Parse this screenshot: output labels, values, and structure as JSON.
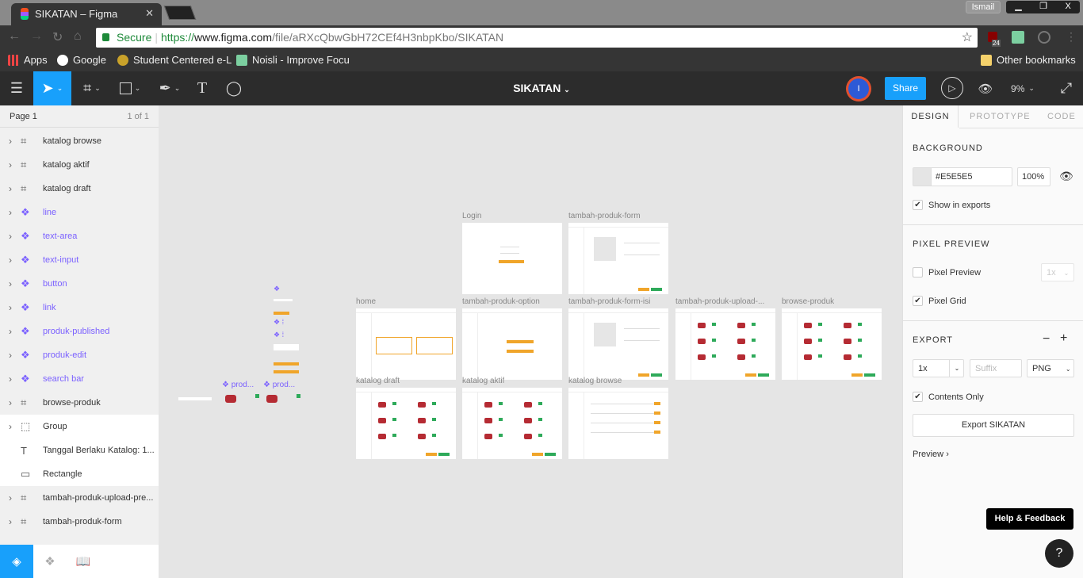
{
  "browser": {
    "tab_title": "SIKATAN – Figma",
    "user": "Ismail",
    "secure_label": "Secure",
    "url_scheme": "https://",
    "url_domain": "www.figma.com",
    "url_path": "/file/aRXcQbwGbH72CEf4H3nbpKbo/SIKATAN",
    "ext_badge": "24",
    "bookmarks": [
      {
        "label": "Apps"
      },
      {
        "label": "Google"
      },
      {
        "label": "Student Centered e-L"
      },
      {
        "label": "Noisli - Improve Focu"
      }
    ],
    "other_bookmarks": "Other bookmarks"
  },
  "toolbar": {
    "file_title": "SIKATAN",
    "avatar_initial": "I",
    "share_label": "Share",
    "zoom": "9%"
  },
  "layers": {
    "page_name": "Page 1",
    "page_count": "1 of 1",
    "items": [
      {
        "label": "katalog browse",
        "type": "frame"
      },
      {
        "label": "katalog aktif",
        "type": "frame"
      },
      {
        "label": "katalog draft",
        "type": "frame"
      },
      {
        "label": "line",
        "type": "component"
      },
      {
        "label": "text-area",
        "type": "component"
      },
      {
        "label": "text-input",
        "type": "component"
      },
      {
        "label": "button",
        "type": "component"
      },
      {
        "label": "link",
        "type": "component"
      },
      {
        "label": "produk-published",
        "type": "component"
      },
      {
        "label": "produk-edit",
        "type": "component"
      },
      {
        "label": "search bar",
        "type": "component"
      },
      {
        "label": "browse-produk",
        "type": "frame"
      },
      {
        "label": "Group",
        "type": "group"
      },
      {
        "label": "Tanggal Berlaku Katalog: 1...",
        "type": "text"
      },
      {
        "label": "Rectangle",
        "type": "rect"
      },
      {
        "label": "tambah-produk-upload-pre...",
        "type": "frame"
      },
      {
        "label": "tambah-produk-form",
        "type": "frame"
      }
    ]
  },
  "canvas": {
    "background": "#E5E5E5",
    "frames": [
      {
        "label": "Login"
      },
      {
        "label": "tambah-produk-form"
      },
      {
        "label": "home"
      },
      {
        "label": "tambah-produk-option"
      },
      {
        "label": "tambah-produk-form-isi"
      },
      {
        "label": "tambah-produk-upload-..."
      },
      {
        "label": "browse-produk"
      },
      {
        "label": "katalog draft"
      },
      {
        "label": "katalog aktif"
      },
      {
        "label": "katalog browse"
      }
    ],
    "component_labels": [
      "prod...",
      "prod..."
    ]
  },
  "design_panel": {
    "tabs": [
      "DESIGN",
      "PROTOTYPE",
      "CODE"
    ],
    "background_title": "BACKGROUND",
    "bg_color": "#E5E5E5",
    "bg_opacity": "100%",
    "show_in_exports": "Show in exports",
    "pixel_preview_title": "PIXEL PREVIEW",
    "pixel_preview": "Pixel Preview",
    "pixel_preview_scale": "1x",
    "pixel_grid": "Pixel Grid",
    "export_title": "EXPORT",
    "export_scale": "1x",
    "suffix_placeholder": "Suffix",
    "format": "PNG",
    "contents_only": "Contents Only",
    "export_button": "Export SIKATAN",
    "preview": "Preview"
  },
  "help": {
    "label": "Help & Feedback",
    "button": "?"
  },
  "colors": {
    "accent": "#18A0FB",
    "component": "#7B61FF",
    "toolbar": "#2C2C2C"
  }
}
